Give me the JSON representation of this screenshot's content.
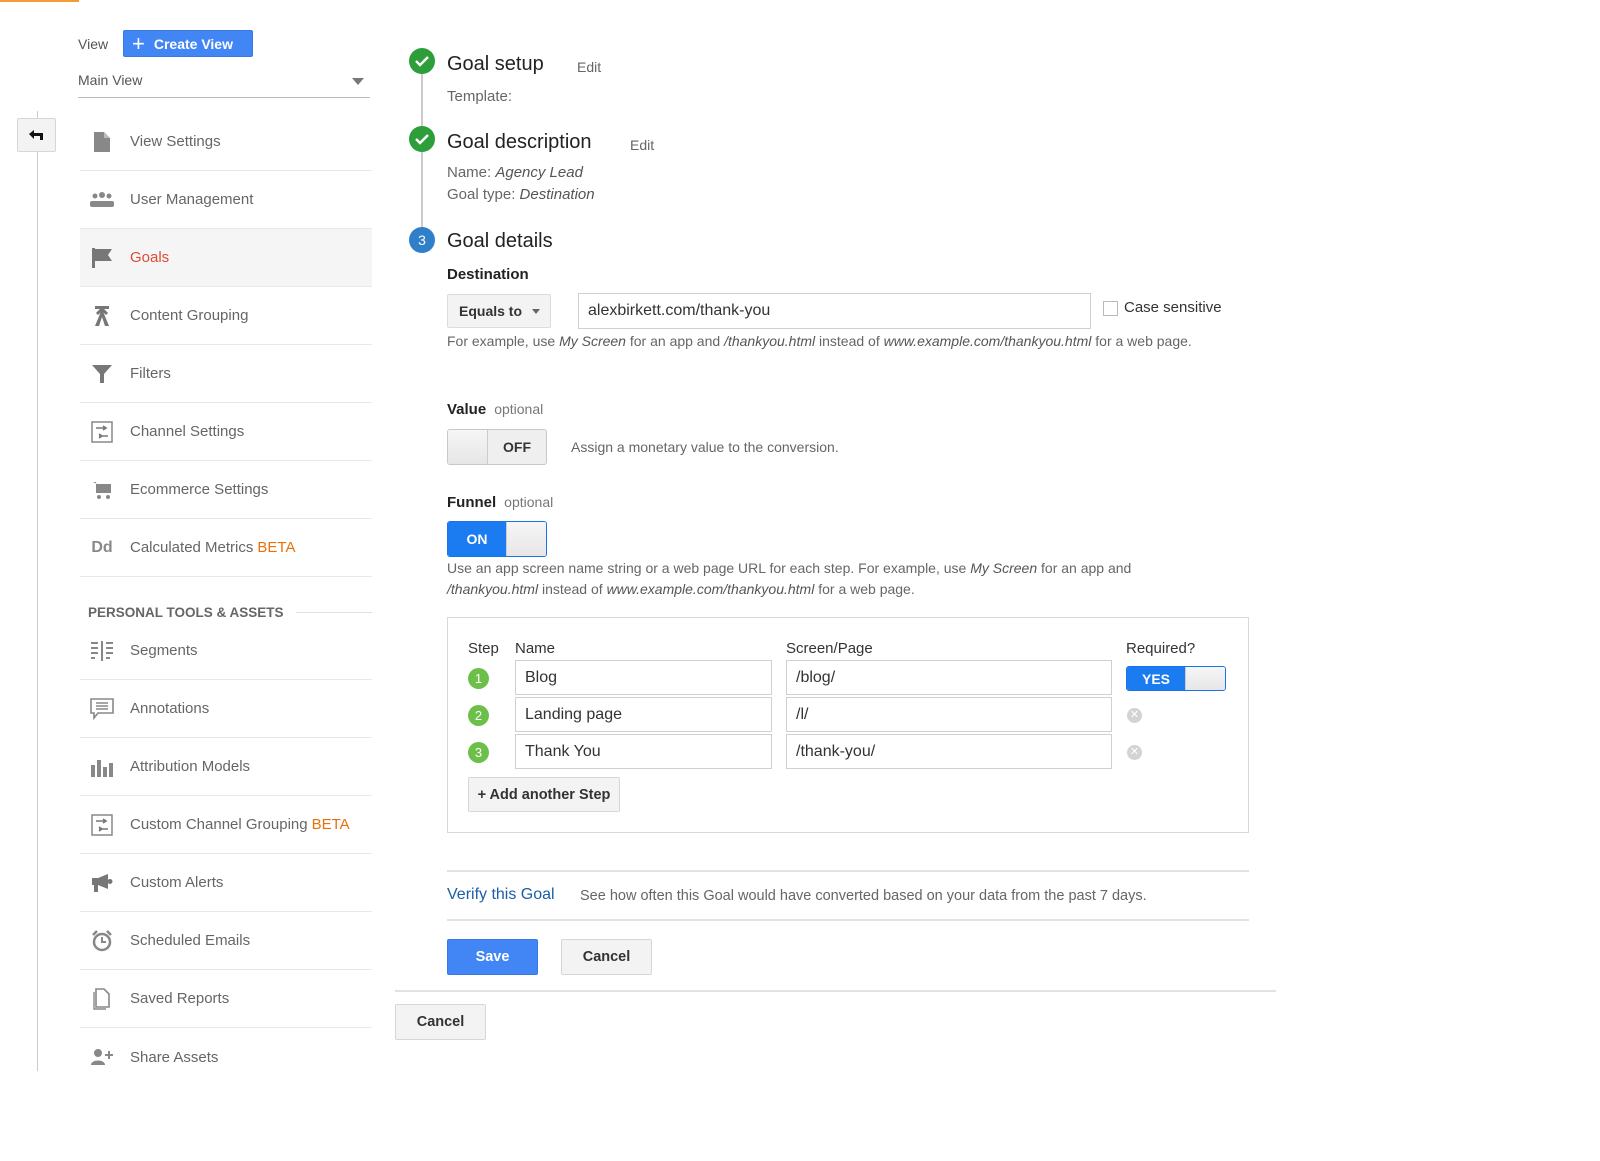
{
  "view_selector": {
    "label": "View",
    "create_view_label": "Create View",
    "selected_view": "Main View"
  },
  "nav": {
    "items": [
      {
        "label": "View Settings",
        "icon": "document-icon",
        "active": false
      },
      {
        "label": "User Management",
        "icon": "users-icon",
        "active": false
      },
      {
        "label": "Goals",
        "icon": "flag-icon",
        "active": true
      },
      {
        "label": "Content Grouping",
        "icon": "merge-icon",
        "active": false
      },
      {
        "label": "Filters",
        "icon": "filter-icon",
        "active": false
      },
      {
        "label": "Channel Settings",
        "icon": "channel-icon",
        "active": false
      },
      {
        "label": "Ecommerce Settings",
        "icon": "cart-icon",
        "active": false
      },
      {
        "label": "Calculated Metrics",
        "badge": "BETA",
        "icon": "dd-icon",
        "active": false
      }
    ],
    "section_title": "PERSONAL TOOLS & ASSETS",
    "personal_items": [
      {
        "label": "Segments",
        "icon": "segments-icon"
      },
      {
        "label": "Annotations",
        "icon": "annotation-icon"
      },
      {
        "label": "Attribution Models",
        "icon": "bar-chart-icon"
      },
      {
        "label": "Custom Channel Grouping",
        "badge": "BETA",
        "icon": "channel-icon"
      },
      {
        "label": "Custom Alerts",
        "icon": "megaphone-icon"
      },
      {
        "label": "Scheduled Emails",
        "icon": "alarm-clock-icon"
      },
      {
        "label": "Saved Reports",
        "icon": "saved-doc-icon"
      },
      {
        "label": "Share Assets",
        "icon": "add-person-icon"
      }
    ]
  },
  "goal": {
    "setup": {
      "title": "Goal setup",
      "edit": "Edit",
      "template_label": "Template:"
    },
    "description": {
      "title": "Goal description",
      "edit": "Edit",
      "name_label": "Name:",
      "name_value": "Agency Lead",
      "type_label": "Goal type:",
      "type_value": "Destination"
    },
    "details": {
      "step_number": "3",
      "title": "Goal details",
      "destination_label": "Destination",
      "match_type": "Equals to",
      "destination_value": "alexbirkett.com/thank-you",
      "case_sensitive_label": "Case sensitive",
      "case_sensitive_checked": false,
      "destination_hint": {
        "p1": "For example, use ",
        "i1": "My Screen",
        "p2": " for an app and ",
        "i2": "/thankyou.html",
        "p3": " instead of ",
        "i3": "www.example.com/thankyou.html",
        "p4": " for a web page."
      },
      "value_label": "Value",
      "value_optional": "optional",
      "value_toggle": "OFF",
      "value_hint": "Assign a monetary value to the conversion.",
      "funnel_label": "Funnel",
      "funnel_optional": "optional",
      "funnel_toggle": "ON",
      "funnel_hint": {
        "p1": "Use an app screen name string or a web page URL for each step. For example, use ",
        "i1": "My Screen",
        "p2": " for an app and ",
        "i2": "/thankyou.html",
        "p3": " instead of ",
        "i3": "www.example.com/thankyou.html",
        "p4": " for a web page."
      },
      "funnel": {
        "headers": {
          "step": "Step",
          "name": "Name",
          "page": "Screen/Page",
          "required": "Required?"
        },
        "steps": [
          {
            "num": "1",
            "name": "Blog",
            "page": "/blog/"
          },
          {
            "num": "2",
            "name": "Landing page",
            "page": "/l/"
          },
          {
            "num": "3",
            "name": "Thank You",
            "page": "/thank-you/"
          }
        ],
        "required_toggle": "YES",
        "add_step_label": "+ Add another Step"
      },
      "verify_label": "Verify this Goal",
      "verify_hint": "See how often this Goal would have converted based on your data from the past 7 days.",
      "save_label": "Save",
      "cancel_label": "Cancel"
    },
    "outer_cancel_label": "Cancel"
  }
}
